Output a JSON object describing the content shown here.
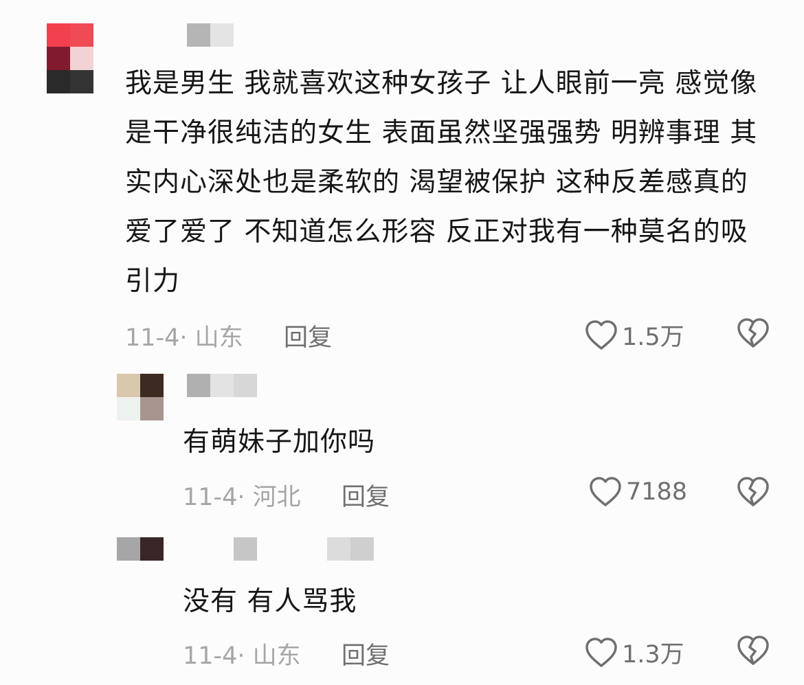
{
  "comments": [
    {
      "text": "我是男生 我就喜欢这种女孩子 让人眼前一亮 感觉像是干净很纯洁的女生 表面虽然坚强强势 明辨事理 其实内心深处也是柔软的 渴望被保护 这种反差感真的爱了爱了 不知道怎么形容 反正对我有一种莫名的吸引力",
      "date_location": "11-4· 山东",
      "reply_label": "回复",
      "like_count": "1.5万"
    },
    {
      "text": "有萌妹子加你吗",
      "date_location": "11-4· 河北",
      "reply_label": "回复",
      "like_count": "7188"
    },
    {
      "text": "没有 有人骂我",
      "date_location": "11-4· 山东",
      "reply_label": "回复",
      "like_count": "1.3万"
    }
  ],
  "icons": {
    "like": "heart-outline-icon",
    "dislike": "broken-heart-icon"
  },
  "colors": {
    "background": "#fcfcfc",
    "text": "#161616",
    "meta": "#a6a6a6",
    "action": "#6f6f6f"
  }
}
